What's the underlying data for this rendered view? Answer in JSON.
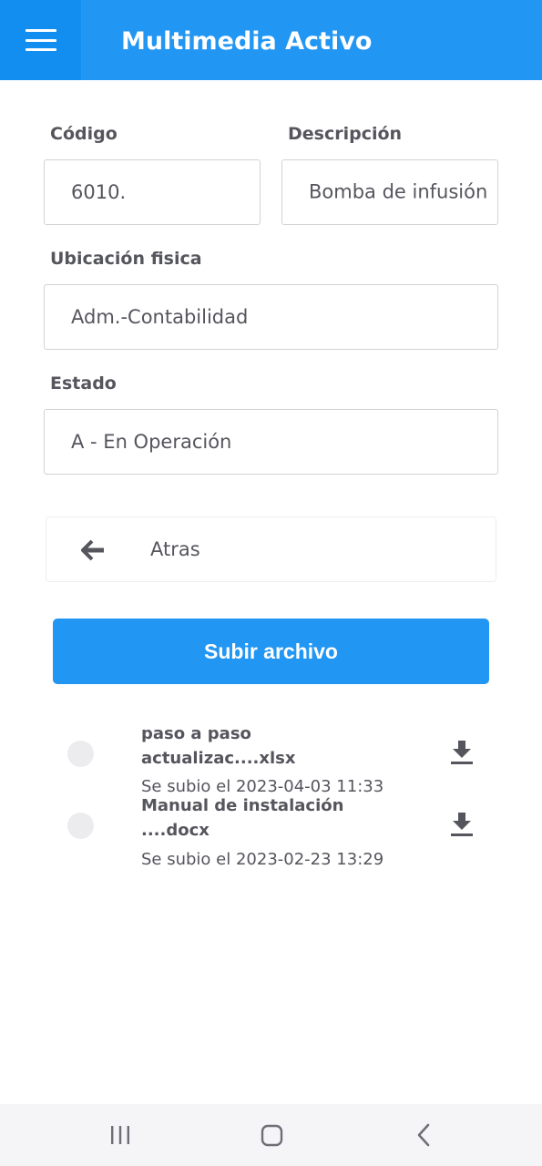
{
  "appbar": {
    "title": "Multimedia Activo",
    "menu_icon": "hamburger-menu-icon"
  },
  "form": {
    "codigo": {
      "label": "Código",
      "value": "6010."
    },
    "descripcion": {
      "label": "Descripción",
      "value": "Bomba de infusión"
    },
    "ubicacion": {
      "label": "Ubicación fisica",
      "value": "Adm.-Contabilidad"
    },
    "estado": {
      "label": "Estado",
      "value": "A - En Operación"
    }
  },
  "back": {
    "label": "Atras",
    "icon": "arrow-left-icon"
  },
  "upload": {
    "label": "Subir archivo"
  },
  "files": [
    {
      "name": "paso a paso actualizac....xlsx",
      "date": "Se subio el 2023-04-03 11:33",
      "icon": "download-icon"
    },
    {
      "name": "Manual de instalación ....docx",
      "date": "Se subio el 2023-02-23 13:29",
      "icon": "download-icon"
    }
  ],
  "colors": {
    "primary": "#2196f3",
    "menu_bg": "#118ef0",
    "text": "#55555d",
    "border": "#d2d2d6"
  },
  "system_nav": {
    "recents_icon": "recents-icon",
    "home_icon": "home-icon",
    "back_icon": "back-icon"
  }
}
